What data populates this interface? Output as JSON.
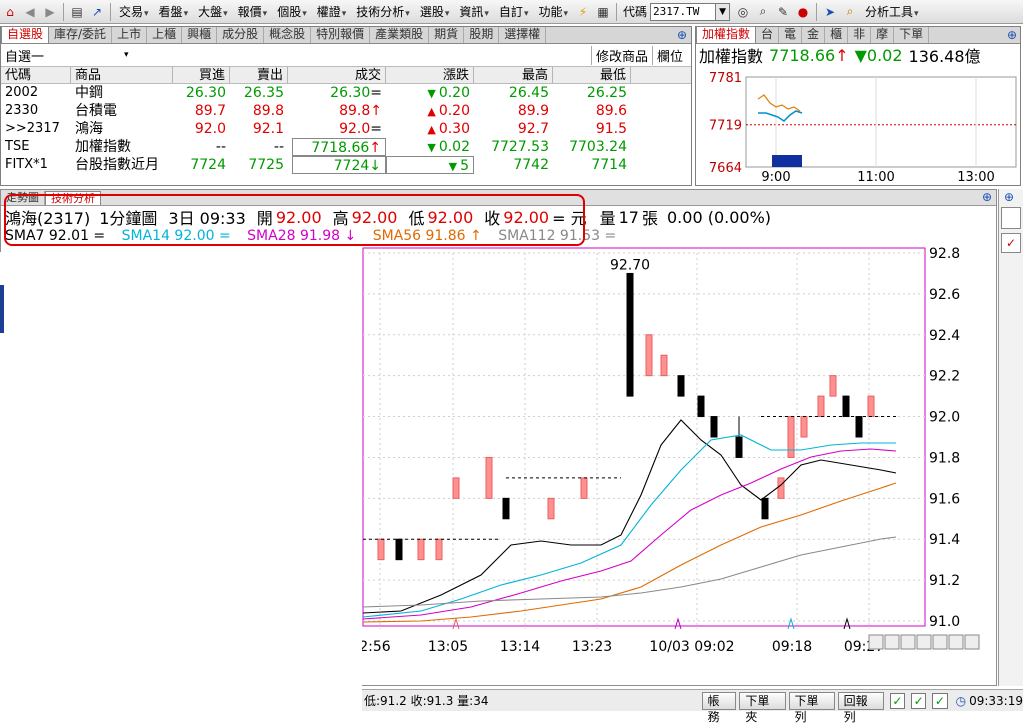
{
  "toolbar": {
    "menus": [
      "交易",
      "看盤",
      "大盤",
      "報價",
      "個股",
      "權證",
      "技術分析",
      "選股",
      "資訊",
      "自訂",
      "功能"
    ],
    "code_label": "代碼",
    "code_value": "2317.TW",
    "analysis_tools": "分析工具"
  },
  "watchlist": {
    "tabs": [
      "自選股",
      "庫存/委託",
      "上市",
      "上櫃",
      "興櫃",
      "成分股",
      "概念股",
      "特別報價",
      "產業類股",
      "期貨",
      "股期",
      "選擇權"
    ],
    "list_name": "自選一",
    "modify_label": "修改商品",
    "column_label": "欄位",
    "headers": [
      "代碼",
      "商品",
      "買進",
      "賣出",
      "成交",
      "漲跌",
      "最高",
      "最低"
    ],
    "rows": [
      {
        "code": "2002",
        "name": "中鋼",
        "bid": "26.30",
        "ask": "26.35",
        "last": "26.30",
        "mark": "=",
        "chg": "0.20",
        "dir": "down",
        "high": "26.45",
        "low": "26.25",
        "color": "green"
      },
      {
        "code": "2330",
        "name": "台積電",
        "bid": "89.7",
        "ask": "89.8",
        "last": "89.8",
        "mark": "↑",
        "chg": "0.20",
        "dir": "up",
        "high": "89.9",
        "low": "89.6",
        "color": "red"
      },
      {
        "code": ">>2317",
        "name": "鴻海",
        "bid": "92.0",
        "ask": "92.1",
        "last": "92.0",
        "mark": "=",
        "chg": "0.30",
        "dir": "up",
        "high": "92.7",
        "low": "91.5",
        "color": "red"
      },
      {
        "code": "TSE",
        "name": "加權指數",
        "bid": "--",
        "ask": "--",
        "last": "7718.66",
        "mark": "↑",
        "chg": "0.02",
        "dir": "down",
        "high": "7727.53",
        "low": "7703.24",
        "color": "green"
      },
      {
        "code": "FITX*1",
        "name": "台股指數近月",
        "bid": "7724",
        "ask": "7725",
        "last": "7724",
        "mark": "↓",
        "chg": "5",
        "dir": "down",
        "high": "7742",
        "low": "7714",
        "color": "green"
      }
    ]
  },
  "index_panel": {
    "tabs": [
      "加權指數",
      "台",
      "電",
      "金",
      "櫃",
      "非",
      "摩",
      "下單"
    ],
    "name": "加權指數",
    "value": "7718.66",
    "change": "0.02",
    "volume": "136.48億",
    "y_labels": [
      "7781",
      "7719",
      "7664"
    ],
    "x_labels": [
      "9:00",
      "11:00",
      "13:00"
    ]
  },
  "tech_chart": {
    "tabs": [
      "走勢圖",
      "技術分析"
    ],
    "title": "鴻海(2317)",
    "period": "1分鐘圖",
    "datetime": "3日 09:33",
    "open_label": "開",
    "open": "92.00",
    "high_label": "高",
    "high": "92.00",
    "low_label": "低",
    "low": "92.00",
    "close_label": "收",
    "close": "92.00",
    "unit": "= 元",
    "vol_label": "量",
    "vol": "17",
    "vol_unit": "張",
    "change": "0.00 (0.00%)",
    "sma7": "SMA7 92.01 =",
    "sma14": "SMA14 92.00 =",
    "sma28": "SMA28 91.98 ↓",
    "sma56": "SMA56 91.86 ↑",
    "sma112": "SMA112 91.53 ="
  },
  "chart_data": {
    "type": "candlestick",
    "y_ticks": [
      "92.8",
      "92.6",
      "92.4",
      "92.2",
      "92.0",
      "91.8",
      "91.6",
      "91.4",
      "91.2",
      "91.0"
    ],
    "ylim": [
      91.0,
      92.8
    ],
    "x_labels": [
      "2:56",
      "13:05",
      "13:14",
      "13:23",
      "10/03 09:02",
      "09:18",
      "09:27"
    ],
    "max_label": "92.70",
    "candles": [
      {
        "o": 91.3,
        "h": 91.4,
        "l": 91.3,
        "c": 91.4
      },
      {
        "o": 91.4,
        "h": 91.4,
        "l": 91.3,
        "c": 91.3
      },
      {
        "o": 91.3,
        "h": 91.4,
        "l": 91.3,
        "c": 91.4
      },
      {
        "o": 91.3,
        "h": 91.4,
        "l": 91.3,
        "c": 91.4
      },
      {
        "o": 91.6,
        "h": 91.7,
        "l": 91.6,
        "c": 91.7
      },
      {
        "o": 91.6,
        "h": 91.8,
        "l": 91.6,
        "c": 91.8
      },
      {
        "o": 91.6,
        "h": 91.6,
        "l": 91.5,
        "c": 91.5
      },
      {
        "o": 91.5,
        "h": 91.6,
        "l": 91.5,
        "c": 91.6
      },
      {
        "o": 91.6,
        "h": 91.7,
        "l": 91.6,
        "c": 91.7
      },
      {
        "o": 92.7,
        "h": 92.7,
        "l": 92.1,
        "c": 92.1
      },
      {
        "o": 92.2,
        "h": 92.4,
        "l": 92.2,
        "c": 92.4
      },
      {
        "o": 92.2,
        "h": 92.3,
        "l": 92.2,
        "c": 92.3
      },
      {
        "o": 92.2,
        "h": 92.2,
        "l": 92.1,
        "c": 92.1
      },
      {
        "o": 92.1,
        "h": 92.1,
        "l": 92.0,
        "c": 92.0
      },
      {
        "o": 92.0,
        "h": 92.0,
        "l": 91.9,
        "c": 91.9
      },
      {
        "o": 91.9,
        "h": 92.0,
        "l": 91.8,
        "c": 91.8
      },
      {
        "o": 91.6,
        "h": 91.6,
        "l": 91.5,
        "c": 91.5
      },
      {
        "o": 91.6,
        "h": 91.7,
        "l": 91.6,
        "c": 91.7
      },
      {
        "o": 91.8,
        "h": 92.0,
        "l": 91.8,
        "c": 92.0
      },
      {
        "o": 91.9,
        "h": 92.0,
        "l": 91.9,
        "c": 92.0
      },
      {
        "o": 92.0,
        "h": 92.1,
        "l": 92.0,
        "c": 92.1
      },
      {
        "o": 92.1,
        "h": 92.2,
        "l": 92.1,
        "c": 92.2
      },
      {
        "o": 92.1,
        "h": 92.1,
        "l": 92.0,
        "c": 92.0
      },
      {
        "o": 92.0,
        "h": 92.0,
        "l": 91.9,
        "c": 91.9
      },
      {
        "o": 92.0,
        "h": 92.1,
        "l": 92.0,
        "c": 92.1
      }
    ]
  },
  "status": {
    "quote": "低:91.2 收:91.3 量:34",
    "buttons": [
      "帳務",
      "下單夾",
      "下單列",
      "回報列"
    ],
    "time": "09:33:19"
  }
}
